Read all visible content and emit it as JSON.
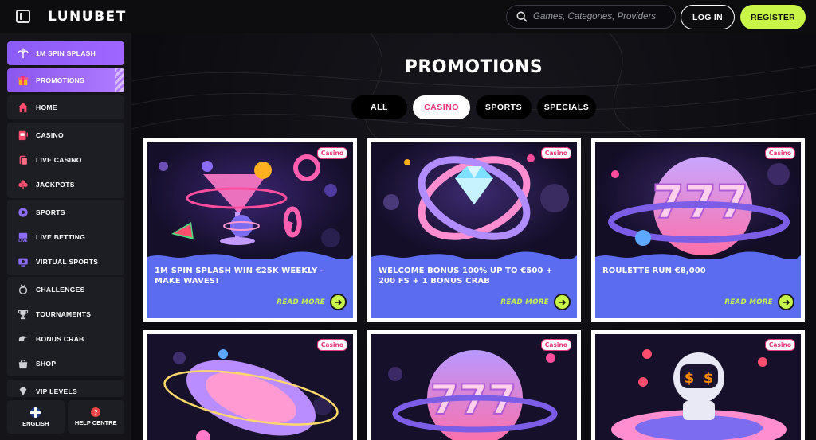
{
  "header": {
    "logo": "LUNUBET",
    "search_placeholder": "Games, Categories, Providers",
    "login_label": "LOG IN",
    "register_label": "REGISTER"
  },
  "sidebar": {
    "top_items": [
      {
        "label": "1M SPIN SPLASH",
        "icon": "palm-tree-icon"
      },
      {
        "label": "PROMOTIONS",
        "icon": "gift-icon"
      },
      {
        "label": "HOME",
        "icon": "home-icon"
      }
    ],
    "casino_group": [
      {
        "label": "CASINO",
        "icon": "slot-machine-icon"
      },
      {
        "label": "LIVE CASINO",
        "icon": "cards-icon"
      },
      {
        "label": "JACKPOTS",
        "icon": "clover-icon"
      }
    ],
    "sports_group": [
      {
        "label": "SPORTS",
        "icon": "soccer-ball-icon"
      },
      {
        "label": "LIVE BETTING",
        "icon": "live-icon"
      },
      {
        "label": "VIRTUAL SPORTS",
        "icon": "monitor-icon"
      }
    ],
    "extras_group": [
      {
        "label": "CHALLENGES",
        "icon": "medal-icon"
      },
      {
        "label": "TOURNAMENTS",
        "icon": "trophy-icon"
      },
      {
        "label": "BONUS CRAB",
        "icon": "crab-icon"
      },
      {
        "label": "SHOP",
        "icon": "shopping-bag-icon"
      }
    ],
    "vip_label": "VIP LEVELS",
    "footer": {
      "language_label": "ENGLISH",
      "help_label": "HELP CENTRE"
    }
  },
  "main": {
    "title": "PROMOTIONS",
    "tabs": [
      {
        "label": "ALL",
        "active": false
      },
      {
        "label": "CASINO",
        "active": true
      },
      {
        "label": "SPORTS",
        "active": false
      },
      {
        "label": "SPECIALS",
        "active": false
      }
    ],
    "cards": [
      {
        "badge": "Casino",
        "title": "1M SPIN SPLASH WIN €25K WEEKLY – MAKE WAVES!",
        "cta": "READ MORE"
      },
      {
        "badge": "Casino",
        "title": "WELCOME BONUS 100% UP TO €500 + 200 FS + 1 BONUS CRAB",
        "cta": "READ MORE"
      },
      {
        "badge": "Casino",
        "title": "ROULETTE RUN €8,000",
        "cta": "READ MORE"
      },
      {
        "badge": "Casino",
        "title": "",
        "cta": ""
      },
      {
        "badge": "Casino",
        "title": "",
        "cta": ""
      },
      {
        "badge": "Casino",
        "title": "",
        "cta": ""
      }
    ]
  },
  "colors": {
    "accent_lime": "#c8f548",
    "accent_purple": "#8b5cf6",
    "badge_pink": "#e8347a",
    "card_blue": "#5b6cf0"
  }
}
